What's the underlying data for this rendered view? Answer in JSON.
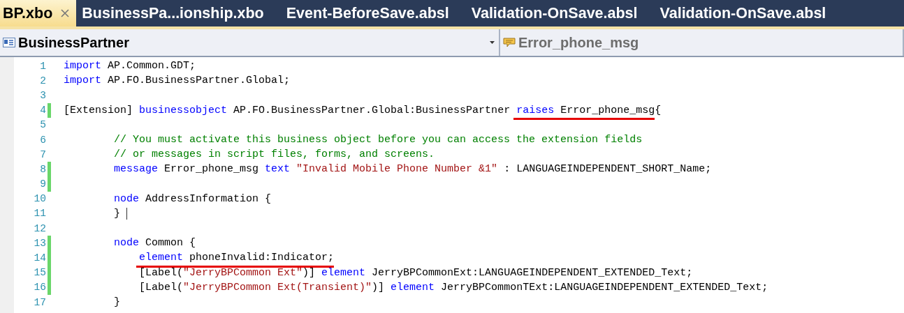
{
  "tabs": [
    {
      "label": "BP.xbo",
      "selected": true
    },
    {
      "label": "BusinessPa...ionship.xbo",
      "selected": false
    },
    {
      "label": "Event-BeforeSave.absl",
      "selected": false
    },
    {
      "label": "Validation-OnSave.absl",
      "selected": false
    },
    {
      "label": "Validation-OnSave.absl",
      "selected": false
    }
  ],
  "navigation": {
    "type_dropdown": "BusinessPartner",
    "member_dropdown": "Error_phone_msg"
  },
  "editor": {
    "lines": [
      {
        "number": "1",
        "changed": false,
        "tokens": [
          {
            "text": "import",
            "kind": "keyword"
          },
          {
            "text": " AP.Common.GDT;",
            "kind": "plain"
          }
        ]
      },
      {
        "number": "2",
        "changed": false,
        "tokens": [
          {
            "text": "import",
            "kind": "keyword"
          },
          {
            "text": " AP.FO.BusinessPartner.Global;",
            "kind": "plain"
          }
        ]
      },
      {
        "number": "3",
        "changed": false
      },
      {
        "number": "4",
        "changed": true,
        "tokens": [
          {
            "text": "[Extension] ",
            "kind": "plain"
          },
          {
            "text": "businessobject",
            "kind": "keyword"
          },
          {
            "text": " AP.FO.BusinessPartner.Global:BusinessPartner",
            "kind": "plain"
          },
          {
            "text": " raises",
            "kind": "keyword",
            "underlined": true
          },
          {
            "text": " Error_phone_msg",
            "kind": "plain",
            "underlined": true
          },
          {
            "text": "{",
            "kind": "plain"
          }
        ]
      },
      {
        "number": "5",
        "changed": false
      },
      {
        "number": "6",
        "changed": false,
        "tokens": [
          {
            "text": "        // You must activate this business object before you can access the extension fields",
            "kind": "comment"
          }
        ]
      },
      {
        "number": "7",
        "changed": false,
        "tokens": [
          {
            "text": "        // or messages in script files, forms, and screens.",
            "kind": "comment"
          }
        ]
      },
      {
        "number": "8",
        "changed": true,
        "tokens": [
          {
            "text": "        message",
            "kind": "keyword"
          },
          {
            "text": " Error_phone_msg ",
            "kind": "plain"
          },
          {
            "text": "text ",
            "kind": "keyword"
          },
          {
            "text": "\"Invalid Mobile Phone Number &1\"",
            "kind": "string"
          },
          {
            "text": " : LANGUAGEINDEPENDENT_SHORT_Name;",
            "kind": "plain"
          }
        ]
      },
      {
        "number": "9",
        "changed": true
      },
      {
        "number": "10",
        "changed": false,
        "tokens": [
          {
            "text": "        node",
            "kind": "keyword"
          },
          {
            "text": " AddressInformation {",
            "kind": "plain"
          }
        ]
      },
      {
        "number": "11",
        "changed": false,
        "cursor": true,
        "tokens": [
          {
            "text": "        } ",
            "kind": "plain"
          }
        ]
      },
      {
        "number": "12",
        "changed": false
      },
      {
        "number": "13",
        "changed": true,
        "tokens": [
          {
            "text": "        node",
            "kind": "keyword"
          },
          {
            "text": " Common {",
            "kind": "plain"
          }
        ]
      },
      {
        "number": "14",
        "changed": true,
        "tokens": [
          {
            "text": "            element",
            "kind": "keyword",
            "underlined": true
          },
          {
            "text": " phoneInvalid:Indicator;",
            "kind": "plain",
            "underlined": true
          }
        ]
      },
      {
        "number": "15",
        "changed": true,
        "tokens": [
          {
            "text": "            [Label(",
            "kind": "plain"
          },
          {
            "text": "\"JerryBPCommon Ext\"",
            "kind": "string"
          },
          {
            "text": ")] ",
            "kind": "plain"
          },
          {
            "text": "element",
            "kind": "keyword"
          },
          {
            "text": " JerryBPCommonExt:LANGUAGEINDEPENDENT_EXTENDED_Text;",
            "kind": "plain"
          }
        ]
      },
      {
        "number": "16",
        "changed": true,
        "tokens": [
          {
            "text": "            [Label(",
            "kind": "plain"
          },
          {
            "text": "\"JerryBPCommon Ext(Transient)\"",
            "kind": "string"
          },
          {
            "text": ")] ",
            "kind": "plain"
          },
          {
            "text": "element",
            "kind": "keyword"
          },
          {
            "text": " JerryBPCommonTExt:LANGUAGEINDEPENDENT_EXTENDED_Text;",
            "kind": "plain"
          }
        ]
      },
      {
        "number": "17",
        "changed": false,
        "tokens": [
          {
            "text": "        }",
            "kind": "plain"
          }
        ]
      }
    ]
  }
}
